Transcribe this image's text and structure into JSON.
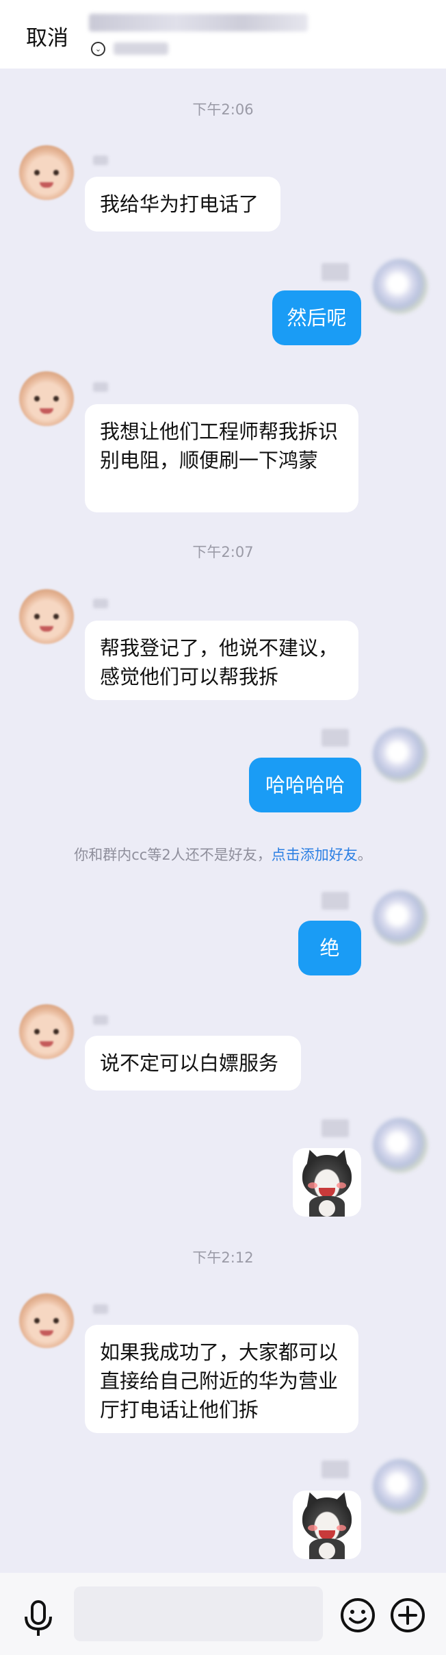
{
  "header": {
    "cancel_label": "取消"
  },
  "timestamps": {
    "t1": "下午2:06",
    "t2": "下午2:07",
    "t3": "下午2:12"
  },
  "messages": [
    {
      "side": "left",
      "text": "我给华为打电话了"
    },
    {
      "side": "right",
      "text": "然后呢"
    },
    {
      "side": "left",
      "text": "我想让他们工程师帮我拆识别电阻，顺便刷一下鸿蒙"
    },
    {
      "side": "left",
      "text": "帮我登记了，他说不建议，感觉他们可以帮我拆"
    },
    {
      "side": "right",
      "text": "哈哈哈哈"
    },
    {
      "side": "right",
      "text": "绝"
    },
    {
      "side": "left",
      "text": "说不定可以白嫖服务"
    },
    {
      "side": "left",
      "text": "如果我成功了，大家都可以直接给自己附近的华为营业厅打电话让他们拆"
    }
  ],
  "system_note": {
    "prefix": "你和群内cc等2人还不是好友，",
    "link": "点击添加好友",
    "suffix": "。"
  },
  "icons": {
    "mic": "microphone-icon",
    "emoji": "smiley-icon",
    "plus": "plus-circle-icon",
    "chevron": "chevron-down-circle-icon"
  },
  "colors": {
    "background": "#ececf6",
    "bubble_self": "#1a9cf5",
    "bubble_other": "#ffffff",
    "link": "#2b7fe3"
  }
}
